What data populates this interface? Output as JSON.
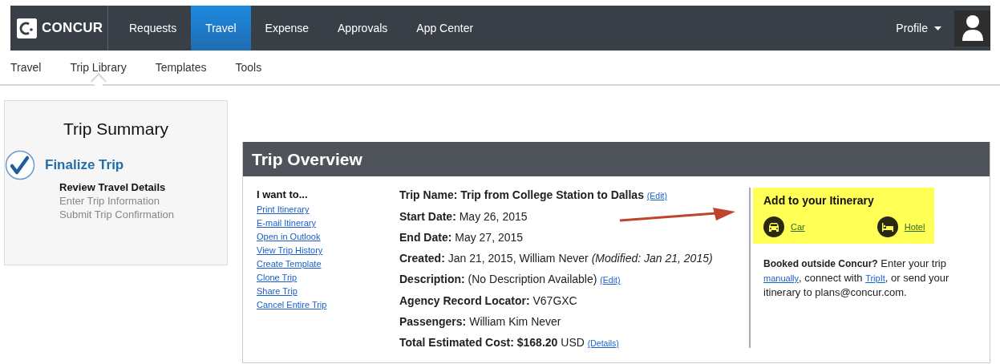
{
  "brand": {
    "name": "CONCUR"
  },
  "nav": [
    {
      "label": "Requests",
      "selected": false
    },
    {
      "label": "Travel",
      "selected": true
    },
    {
      "label": "Expense",
      "selected": false
    },
    {
      "label": "Approvals",
      "selected": false
    },
    {
      "label": "App Center",
      "selected": false
    }
  ],
  "profile": {
    "label": "Profile"
  },
  "subnav": [
    {
      "label": "Travel",
      "selected": false
    },
    {
      "label": "Trip Library",
      "selected": true
    },
    {
      "label": "Templates",
      "selected": false
    },
    {
      "label": "Tools",
      "selected": false
    }
  ],
  "summary": {
    "title": "Trip Summary",
    "stage": "Finalize Trip",
    "steps": [
      {
        "label": "Review Travel Details",
        "current": true
      },
      {
        "label": "Enter Trip Information",
        "current": false
      },
      {
        "label": "Submit Trip Confirmation",
        "current": false
      }
    ]
  },
  "overview": {
    "title": "Trip Overview",
    "actions_heading": "I want to...",
    "actions": [
      "Print Itinerary",
      "E-mail Itinerary",
      "Open in Outlook",
      "View Trip History",
      "Create Template",
      "Clone Trip",
      "Share Trip",
      "Cancel Entire Trip"
    ],
    "details": [
      {
        "label": "Trip Name:",
        "value": "Trip from College Station to Dallas",
        "value_bold": true,
        "link": "(Edit)"
      },
      {
        "label": "Start Date:",
        "value": "May 26, 2015",
        "value_bold": false
      },
      {
        "label": "End Date:",
        "value": "May 27, 2015",
        "value_bold": false
      },
      {
        "label": "Created:",
        "value": "Jan 21, 2015, William Never *(Modified: Jan 21, 2015)*",
        "value_bold": false
      },
      {
        "label": "Description:",
        "value": "(No Description Available)",
        "value_bold": false,
        "link": "(Edit)"
      },
      {
        "label": "Agency Record Locator:",
        "value": "V67GXC",
        "value_bold": false
      },
      {
        "label": "Passengers:",
        "value": "William Kim Never",
        "value_bold": false
      },
      {
        "label": "Total Estimated Cost:",
        "value": "$168.20",
        "value_bold": true,
        "suffix": "USD",
        "link": "(Details)"
      }
    ],
    "add": {
      "heading": "Add to your Itinerary",
      "items": [
        {
          "kind": "car",
          "label": "Car"
        },
        {
          "kind": "hotel",
          "label": "Hotel"
        }
      ]
    },
    "booked": [
      {
        "kind": "bold",
        "text": "Booked outside Concur?"
      },
      {
        "kind": "text",
        "text": " Enter your trip "
      },
      {
        "kind": "link",
        "text": "manually"
      },
      {
        "kind": "text",
        "text": ", connect with "
      },
      {
        "kind": "link",
        "text": "TripIt"
      },
      {
        "kind": "text",
        "text": ", or send your itinerary to plans@concur.com."
      }
    ]
  }
}
